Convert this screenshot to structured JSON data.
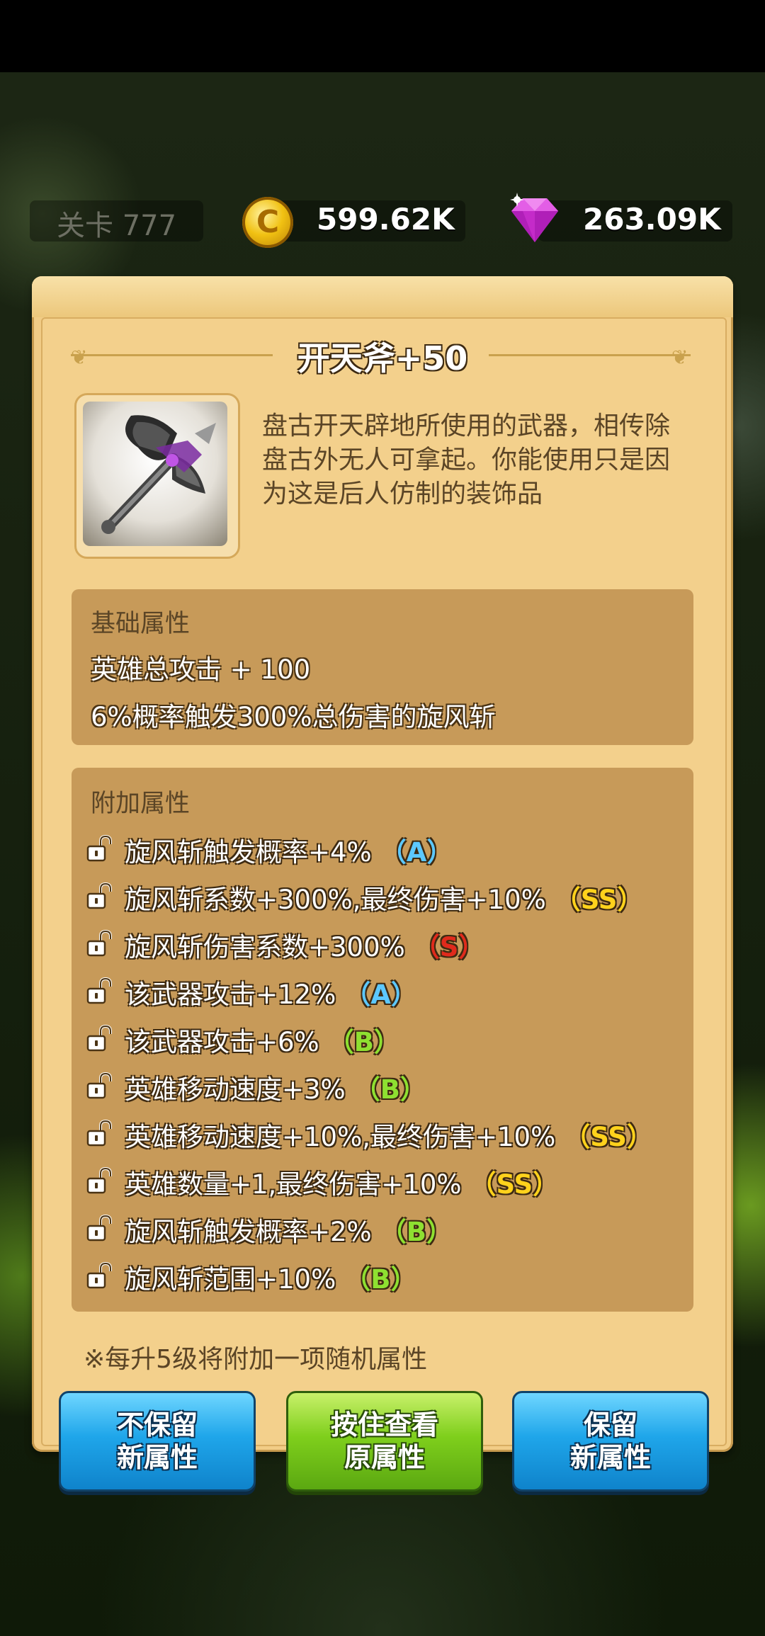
{
  "hud": {
    "level_label": "关卡 777",
    "coins": "599.62K",
    "coin_glyph": "C",
    "gems": "263.09K"
  },
  "item": {
    "title": "开天斧+50",
    "description": "盘古开天辟地所使用的武器，相传除盘古外无人可拿起。你能使用只是因为这是后人仿制的装饰品"
  },
  "base_attributes": {
    "header": "基础属性",
    "lines": [
      "英雄总攻击 + 100",
      "6%概率触发300%总伤害的旋风斩"
    ]
  },
  "extra_attributes": {
    "header": "附加属性",
    "items": [
      {
        "text": "旋风斩触发概率+4%",
        "grade": "（A）",
        "grade_color": "#5cc8ff"
      },
      {
        "text": "旋风斩系数+300%,最终伤害+10%",
        "grade": "（SS）",
        "grade_color": "#ffd21c"
      },
      {
        "text": "旋风斩伤害系数+300%",
        "grade": "（S）",
        "grade_color": "#e02a1c"
      },
      {
        "text": "该武器攻击+12%",
        "grade": "（A）",
        "grade_color": "#5cc8ff"
      },
      {
        "text": "该武器攻击+6%",
        "grade": "（B）",
        "grade_color": "#8ee031"
      },
      {
        "text": "英雄移动速度+3%",
        "grade": "（B）",
        "grade_color": "#8ee031"
      },
      {
        "text": "英雄移动速度+10%,最终伤害+10%",
        "grade": "（SS）",
        "grade_color": "#ffd21c"
      },
      {
        "text": "英雄数量+1,最终伤害+10%",
        "grade": "（SS）",
        "grade_color": "#ffd21c"
      },
      {
        "text": "旋风斩触发概率+2%",
        "grade": "（B）",
        "grade_color": "#8ee031"
      },
      {
        "text": "旋风斩范围+10%",
        "grade": "（B）",
        "grade_color": "#8ee031"
      }
    ]
  },
  "note": "※每升5级将附加一项随机属性",
  "buttons": {
    "discard": "不保留\n新属性",
    "hold_view": "按住查看\n原属性",
    "keep": "保留\n新属性"
  }
}
